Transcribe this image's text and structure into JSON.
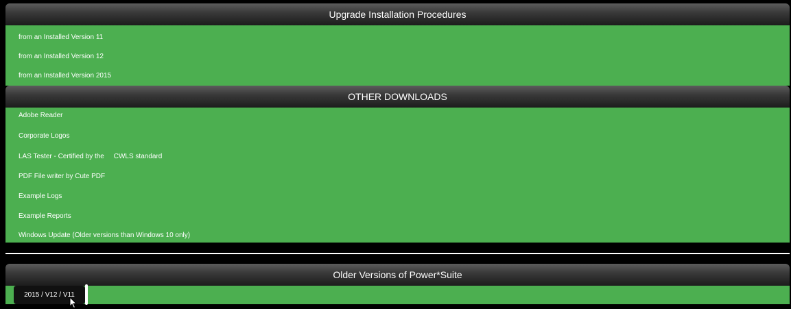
{
  "sections": {
    "upgrade": {
      "title": "Upgrade Installation Procedures",
      "items": [
        "from an Installed Version 11",
        "from an Installed Version 12",
        "from an Installed Version 2015"
      ]
    },
    "downloads": {
      "title": "OTHER DOWNLOADS",
      "items": [
        "Adobe Reader",
        "Corporate Logos",
        "LAS Tester - Certified by the     CWLS standard",
        "PDF File writer by Cute PDF",
        "Example Logs",
        "Example Reports",
        "Windows Update (Older versions than Windows 10 only)"
      ]
    },
    "older": {
      "title": "Older Versions of Power*Suite",
      "tab_label": "2015 / V12 / V11"
    }
  },
  "colors": {
    "panel_green": "#4caf50",
    "header_dark": "#2a2a2a",
    "text": "#ffffff"
  }
}
